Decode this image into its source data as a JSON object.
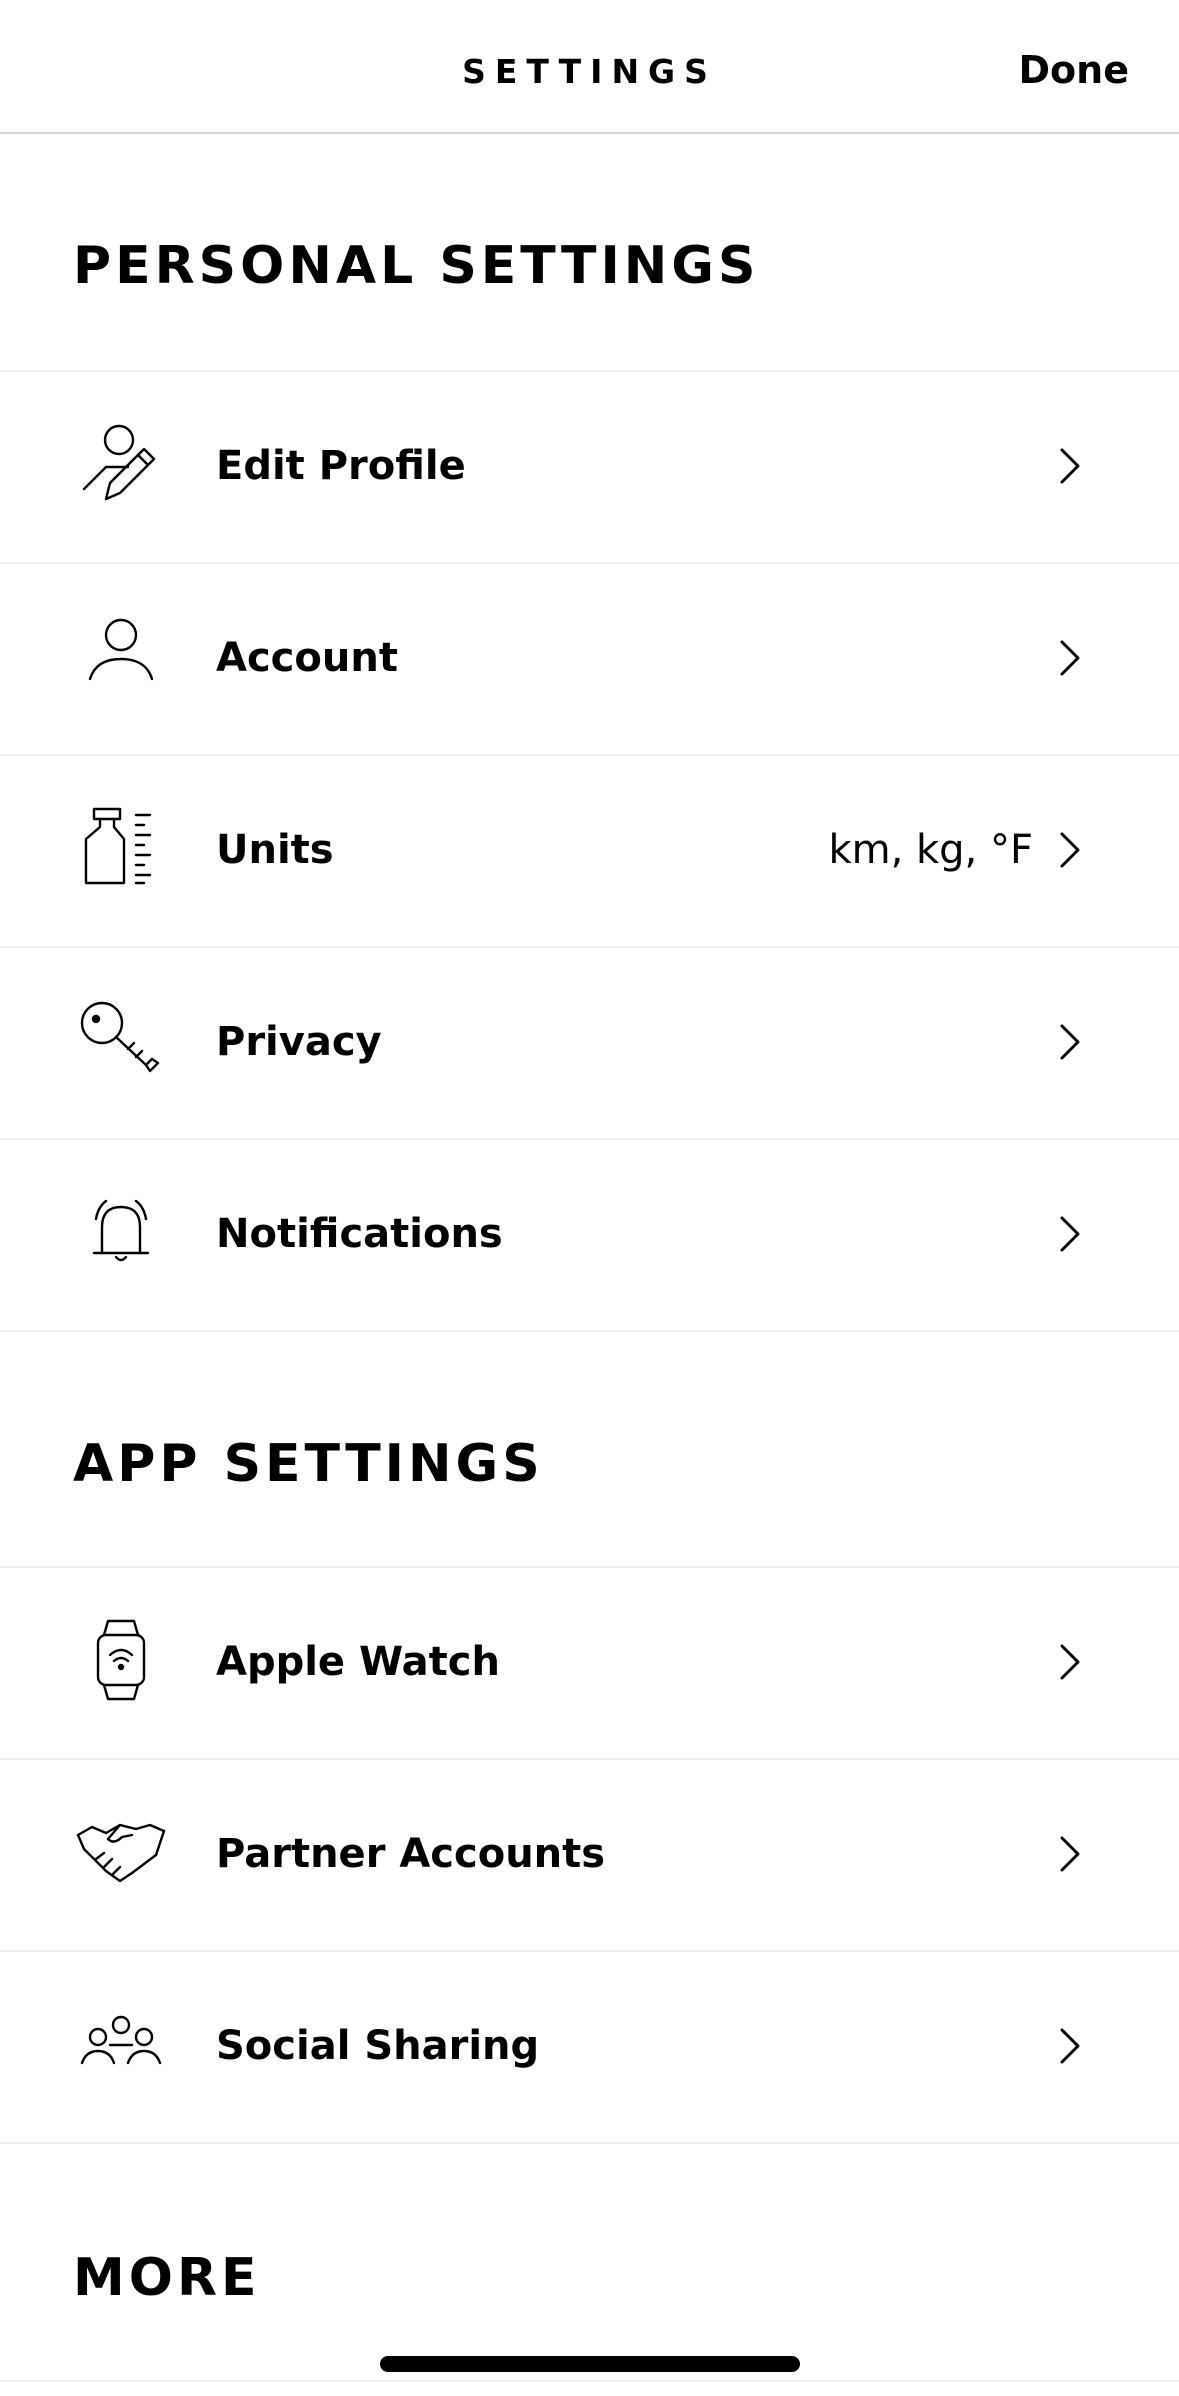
{
  "header": {
    "title": "SETTINGS",
    "done_label": "Done"
  },
  "sections": {
    "personal": {
      "title": "PERSONAL SETTINGS",
      "items": [
        {
          "label": "Edit Profile",
          "icon": "edit-profile-icon"
        },
        {
          "label": "Account",
          "icon": "person-icon"
        },
        {
          "label": "Units",
          "icon": "units-icon",
          "value": "km, kg, °F"
        },
        {
          "label": "Privacy",
          "icon": "key-icon"
        },
        {
          "label": "Notifications",
          "icon": "bell-icon"
        }
      ]
    },
    "app": {
      "title": "APP SETTINGS",
      "items": [
        {
          "label": "Apple Watch",
          "icon": "watch-icon"
        },
        {
          "label": "Partner Accounts",
          "icon": "handshake-icon"
        },
        {
          "label": "Social Sharing",
          "icon": "group-icon"
        }
      ]
    },
    "more": {
      "title": "MORE"
    }
  },
  "colors": {
    "text": "#000000",
    "background": "#ffffff",
    "divider": "#efefef",
    "header_border": "#d4d4d4"
  }
}
